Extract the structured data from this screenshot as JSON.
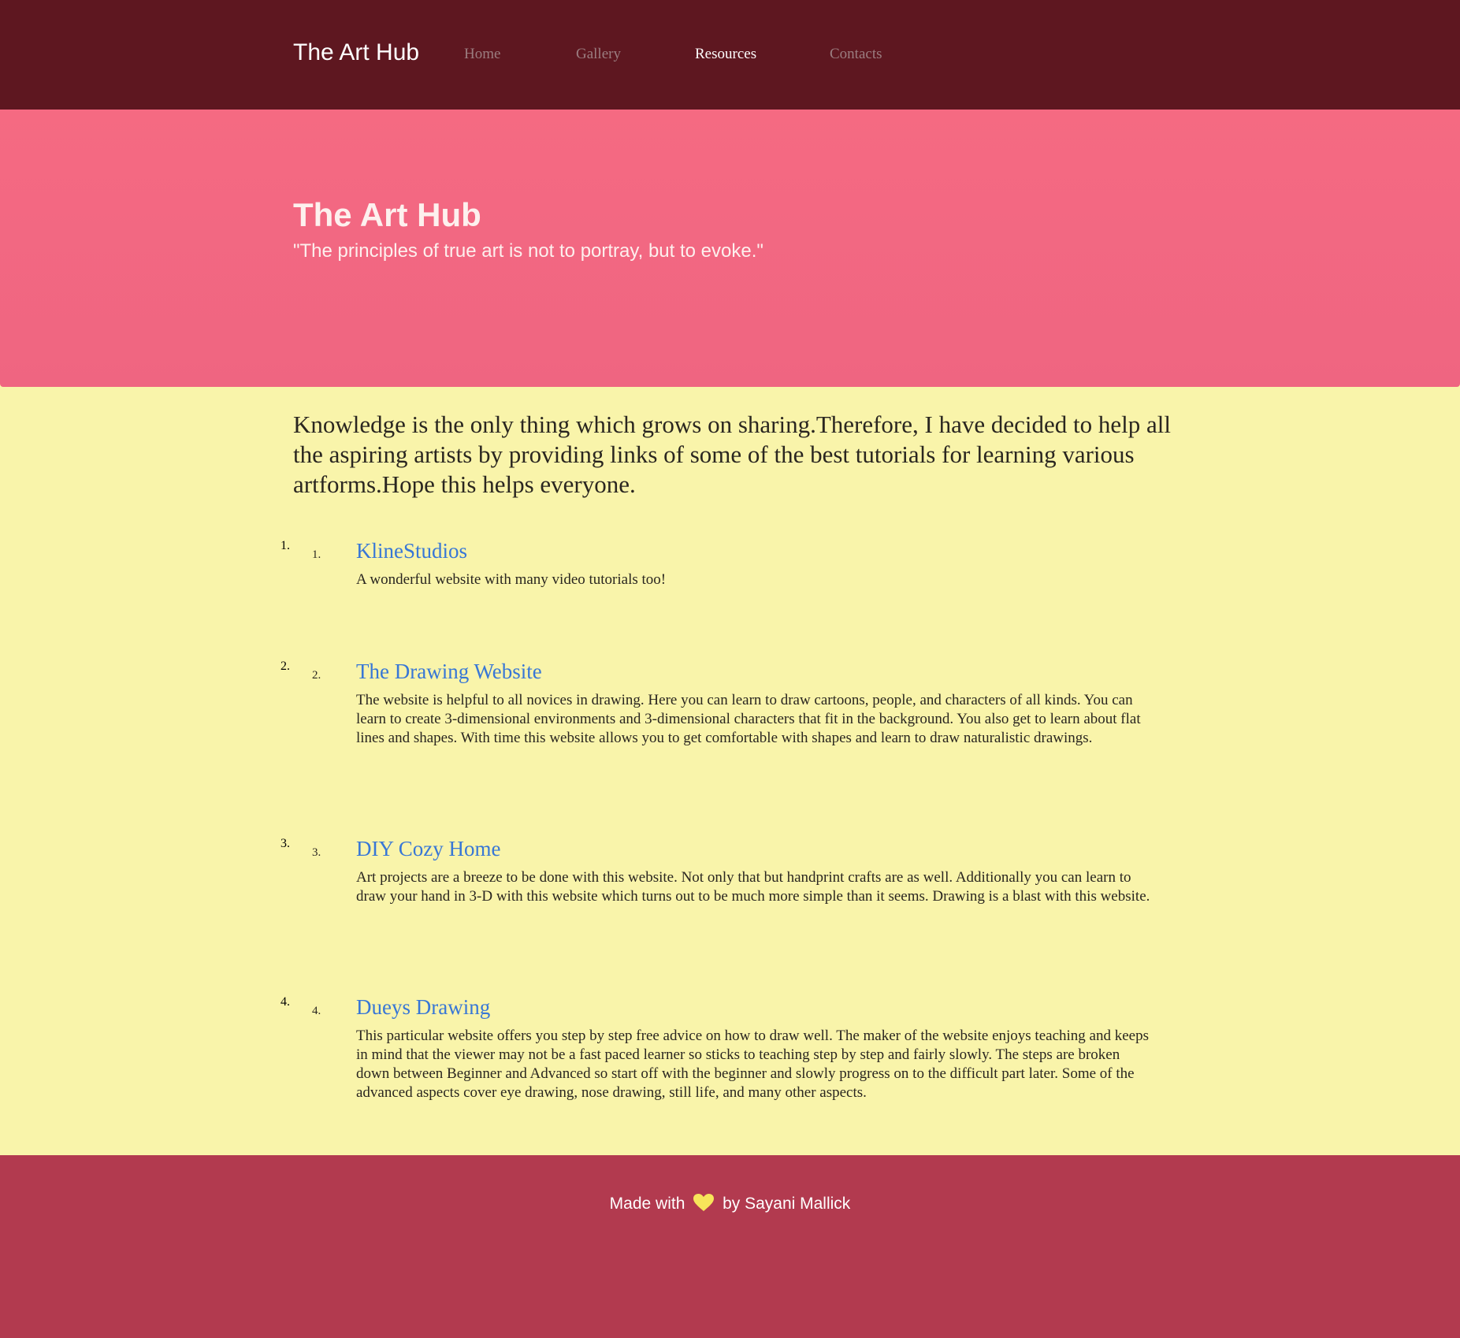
{
  "nav": {
    "brand": "The Art Hub",
    "links": [
      {
        "label": "Home",
        "active": false
      },
      {
        "label": "Gallery",
        "active": false
      },
      {
        "label": "Resources",
        "active": true
      },
      {
        "label": "Contacts",
        "active": false
      }
    ]
  },
  "hero": {
    "title": "The Art Hub",
    "quote": "\"The principles of true art is not to portray, but to evoke.\""
  },
  "intro": "Knowledge is the only thing which grows on sharing.Therefore, I have decided to help all the aspiring artists by providing links of some of the best tutorials for learning various artforms.Hope this helps everyone.",
  "resources": [
    {
      "number": "1.",
      "title": "KlineStudios",
      "description": "A wonderful website with many video tutorials too!"
    },
    {
      "number": "2.",
      "title": "The Drawing Website",
      "description": "The website is helpful to all novices in drawing. Here you can learn to draw cartoons, people, and characters of all kinds. You can learn to create 3-dimensional environments and 3-dimensional characters that fit in the background. You also get to learn about flat lines and shapes. With time this website allows you to get comfortable with shapes and learn to draw naturalistic drawings."
    },
    {
      "number": "3.",
      "title": "DIY Cozy Home",
      "description": "Art projects are a breeze to be done with this website. Not only that but handprint crafts are as well. Additionally you can learn to draw your hand in 3-D with this website which turns out to be much more simple than it seems. Drawing is a blast with this website."
    },
    {
      "number": "4.",
      "title": "Dueys Drawing",
      "description": "This particular website offers you step by step free advice on how to draw well. The maker of the website enjoys teaching and keeps in mind that the viewer may not be a fast paced learner so sticks to teaching step by step and fairly slowly. The steps are broken down between Beginner and Advanced so start off with the beginner and slowly progress on to the difficult part later. Some of the advanced aspects cover eye drawing, nose drawing, still life, and many other aspects."
    }
  ],
  "footer": {
    "prefix": "Made with",
    "heart_icon": "heart-icon",
    "suffix": "by Sayani Mallick"
  },
  "colors": {
    "navbar": "#5e1720",
    "hero": "#f26a82",
    "body": "#f9f4aa",
    "footer": "#b23a4f",
    "link": "#3877d6",
    "heart": "#f7e55a"
  }
}
